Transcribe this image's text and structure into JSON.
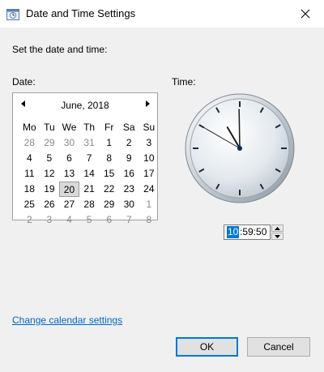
{
  "window": {
    "title": "Date and Time Settings"
  },
  "heading": "Set the date and time:",
  "labels": {
    "date": "Date:",
    "time": "Time:"
  },
  "calendar": {
    "month_label": "June, 2018",
    "weekdays": [
      "Mo",
      "Tu",
      "We",
      "Th",
      "Fr",
      "Sa",
      "Su"
    ],
    "weeks": [
      [
        {
          "d": "28",
          "dim": true
        },
        {
          "d": "29",
          "dim": true
        },
        {
          "d": "30",
          "dim": true
        },
        {
          "d": "31",
          "dim": true
        },
        {
          "d": "1"
        },
        {
          "d": "2"
        },
        {
          "d": "3"
        }
      ],
      [
        {
          "d": "4"
        },
        {
          "d": "5"
        },
        {
          "d": "6"
        },
        {
          "d": "7"
        },
        {
          "d": "8"
        },
        {
          "d": "9"
        },
        {
          "d": "10"
        }
      ],
      [
        {
          "d": "11"
        },
        {
          "d": "12"
        },
        {
          "d": "13"
        },
        {
          "d": "14"
        },
        {
          "d": "15"
        },
        {
          "d": "16"
        },
        {
          "d": "17"
        }
      ],
      [
        {
          "d": "18"
        },
        {
          "d": "19"
        },
        {
          "d": "20",
          "selected": true
        },
        {
          "d": "21"
        },
        {
          "d": "22"
        },
        {
          "d": "23"
        },
        {
          "d": "24"
        }
      ],
      [
        {
          "d": "25"
        },
        {
          "d": "26"
        },
        {
          "d": "27"
        },
        {
          "d": "28"
        },
        {
          "d": "29"
        },
        {
          "d": "30"
        },
        {
          "d": "1",
          "dim": true
        }
      ],
      [
        {
          "d": "2",
          "dim": true
        },
        {
          "d": "3",
          "dim": true
        },
        {
          "d": "4",
          "dim": true
        },
        {
          "d": "5",
          "dim": true
        },
        {
          "d": "6",
          "dim": true
        },
        {
          "d": "7",
          "dim": true
        },
        {
          "d": "8",
          "dim": true
        }
      ]
    ]
  },
  "clock": {
    "hour": 10,
    "minute": 59,
    "second": 50
  },
  "time_field": {
    "hour": "10",
    "rest": ":59:50"
  },
  "link": "Change calendar settings",
  "buttons": {
    "ok": "OK",
    "cancel": "Cancel"
  },
  "icons": {
    "app": "date-time-icon",
    "close": "close-icon",
    "prev": "chevron-left-icon",
    "next": "chevron-right-icon",
    "up": "spin-up-icon",
    "down": "spin-down-icon"
  },
  "colors": {
    "accent": "#0078d7",
    "link": "#0066cc",
    "selected_day": "#d9d9d9"
  }
}
